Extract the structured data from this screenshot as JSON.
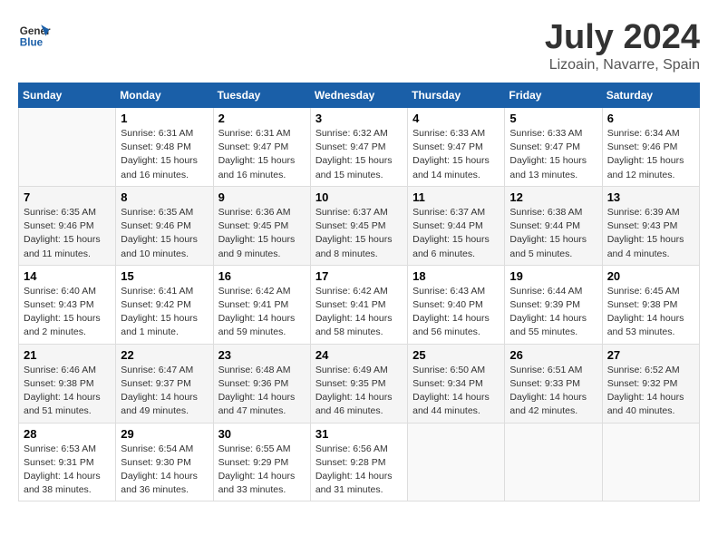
{
  "header": {
    "logo_line1": "General",
    "logo_line2": "Blue",
    "month": "July 2024",
    "location": "Lizoain, Navarre, Spain"
  },
  "columns": [
    "Sunday",
    "Monday",
    "Tuesday",
    "Wednesday",
    "Thursday",
    "Friday",
    "Saturday"
  ],
  "weeks": [
    [
      {
        "num": "",
        "empty": true
      },
      {
        "num": "1",
        "sunrise": "6:31 AM",
        "sunset": "9:48 PM",
        "daylight": "15 hours and 16 minutes."
      },
      {
        "num": "2",
        "sunrise": "6:31 AM",
        "sunset": "9:47 PM",
        "daylight": "15 hours and 16 minutes."
      },
      {
        "num": "3",
        "sunrise": "6:32 AM",
        "sunset": "9:47 PM",
        "daylight": "15 hours and 15 minutes."
      },
      {
        "num": "4",
        "sunrise": "6:33 AM",
        "sunset": "9:47 PM",
        "daylight": "15 hours and 14 minutes."
      },
      {
        "num": "5",
        "sunrise": "6:33 AM",
        "sunset": "9:47 PM",
        "daylight": "15 hours and 13 minutes."
      },
      {
        "num": "6",
        "sunrise": "6:34 AM",
        "sunset": "9:46 PM",
        "daylight": "15 hours and 12 minutes."
      }
    ],
    [
      {
        "num": "7",
        "sunrise": "6:35 AM",
        "sunset": "9:46 PM",
        "daylight": "15 hours and 11 minutes."
      },
      {
        "num": "8",
        "sunrise": "6:35 AM",
        "sunset": "9:46 PM",
        "daylight": "15 hours and 10 minutes."
      },
      {
        "num": "9",
        "sunrise": "6:36 AM",
        "sunset": "9:45 PM",
        "daylight": "15 hours and 9 minutes."
      },
      {
        "num": "10",
        "sunrise": "6:37 AM",
        "sunset": "9:45 PM",
        "daylight": "15 hours and 8 minutes."
      },
      {
        "num": "11",
        "sunrise": "6:37 AM",
        "sunset": "9:44 PM",
        "daylight": "15 hours and 6 minutes."
      },
      {
        "num": "12",
        "sunrise": "6:38 AM",
        "sunset": "9:44 PM",
        "daylight": "15 hours and 5 minutes."
      },
      {
        "num": "13",
        "sunrise": "6:39 AM",
        "sunset": "9:43 PM",
        "daylight": "15 hours and 4 minutes."
      }
    ],
    [
      {
        "num": "14",
        "sunrise": "6:40 AM",
        "sunset": "9:43 PM",
        "daylight": "15 hours and 2 minutes."
      },
      {
        "num": "15",
        "sunrise": "6:41 AM",
        "sunset": "9:42 PM",
        "daylight": "15 hours and 1 minute."
      },
      {
        "num": "16",
        "sunrise": "6:42 AM",
        "sunset": "9:41 PM",
        "daylight": "14 hours and 59 minutes."
      },
      {
        "num": "17",
        "sunrise": "6:42 AM",
        "sunset": "9:41 PM",
        "daylight": "14 hours and 58 minutes."
      },
      {
        "num": "18",
        "sunrise": "6:43 AM",
        "sunset": "9:40 PM",
        "daylight": "14 hours and 56 minutes."
      },
      {
        "num": "19",
        "sunrise": "6:44 AM",
        "sunset": "9:39 PM",
        "daylight": "14 hours and 55 minutes."
      },
      {
        "num": "20",
        "sunrise": "6:45 AM",
        "sunset": "9:38 PM",
        "daylight": "14 hours and 53 minutes."
      }
    ],
    [
      {
        "num": "21",
        "sunrise": "6:46 AM",
        "sunset": "9:38 PM",
        "daylight": "14 hours and 51 minutes."
      },
      {
        "num": "22",
        "sunrise": "6:47 AM",
        "sunset": "9:37 PM",
        "daylight": "14 hours and 49 minutes."
      },
      {
        "num": "23",
        "sunrise": "6:48 AM",
        "sunset": "9:36 PM",
        "daylight": "14 hours and 47 minutes."
      },
      {
        "num": "24",
        "sunrise": "6:49 AM",
        "sunset": "9:35 PM",
        "daylight": "14 hours and 46 minutes."
      },
      {
        "num": "25",
        "sunrise": "6:50 AM",
        "sunset": "9:34 PM",
        "daylight": "14 hours and 44 minutes."
      },
      {
        "num": "26",
        "sunrise": "6:51 AM",
        "sunset": "9:33 PM",
        "daylight": "14 hours and 42 minutes."
      },
      {
        "num": "27",
        "sunrise": "6:52 AM",
        "sunset": "9:32 PM",
        "daylight": "14 hours and 40 minutes."
      }
    ],
    [
      {
        "num": "28",
        "sunrise": "6:53 AM",
        "sunset": "9:31 PM",
        "daylight": "14 hours and 38 minutes."
      },
      {
        "num": "29",
        "sunrise": "6:54 AM",
        "sunset": "9:30 PM",
        "daylight": "14 hours and 36 minutes."
      },
      {
        "num": "30",
        "sunrise": "6:55 AM",
        "sunset": "9:29 PM",
        "daylight": "14 hours and 33 minutes."
      },
      {
        "num": "31",
        "sunrise": "6:56 AM",
        "sunset": "9:28 PM",
        "daylight": "14 hours and 31 minutes."
      },
      {
        "num": "",
        "empty": true
      },
      {
        "num": "",
        "empty": true
      },
      {
        "num": "",
        "empty": true
      }
    ]
  ]
}
